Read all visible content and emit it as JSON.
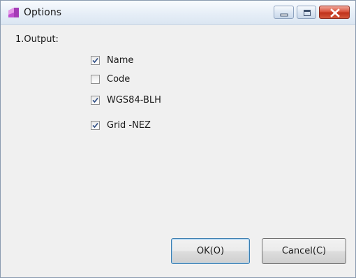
{
  "window": {
    "title": "Options"
  },
  "section": {
    "label": "1.Output:"
  },
  "options": [
    {
      "label": "Name",
      "checked": true
    },
    {
      "label": "Code",
      "checked": false
    },
    {
      "label": "WGS84-BLH",
      "checked": true
    },
    {
      "label": "Grid -NEZ",
      "checked": true
    }
  ],
  "buttons": {
    "ok_label": "OK(O)",
    "cancel_label": "Cancel(C)"
  },
  "icons": {
    "app": "app-icon",
    "minimize": "minimize-icon",
    "maximize": "maximize-icon",
    "close": "close-icon",
    "check": "checkmark-icon"
  },
  "colors": {
    "close_button": "#d9553e",
    "app_icon": "#c04fd0"
  }
}
